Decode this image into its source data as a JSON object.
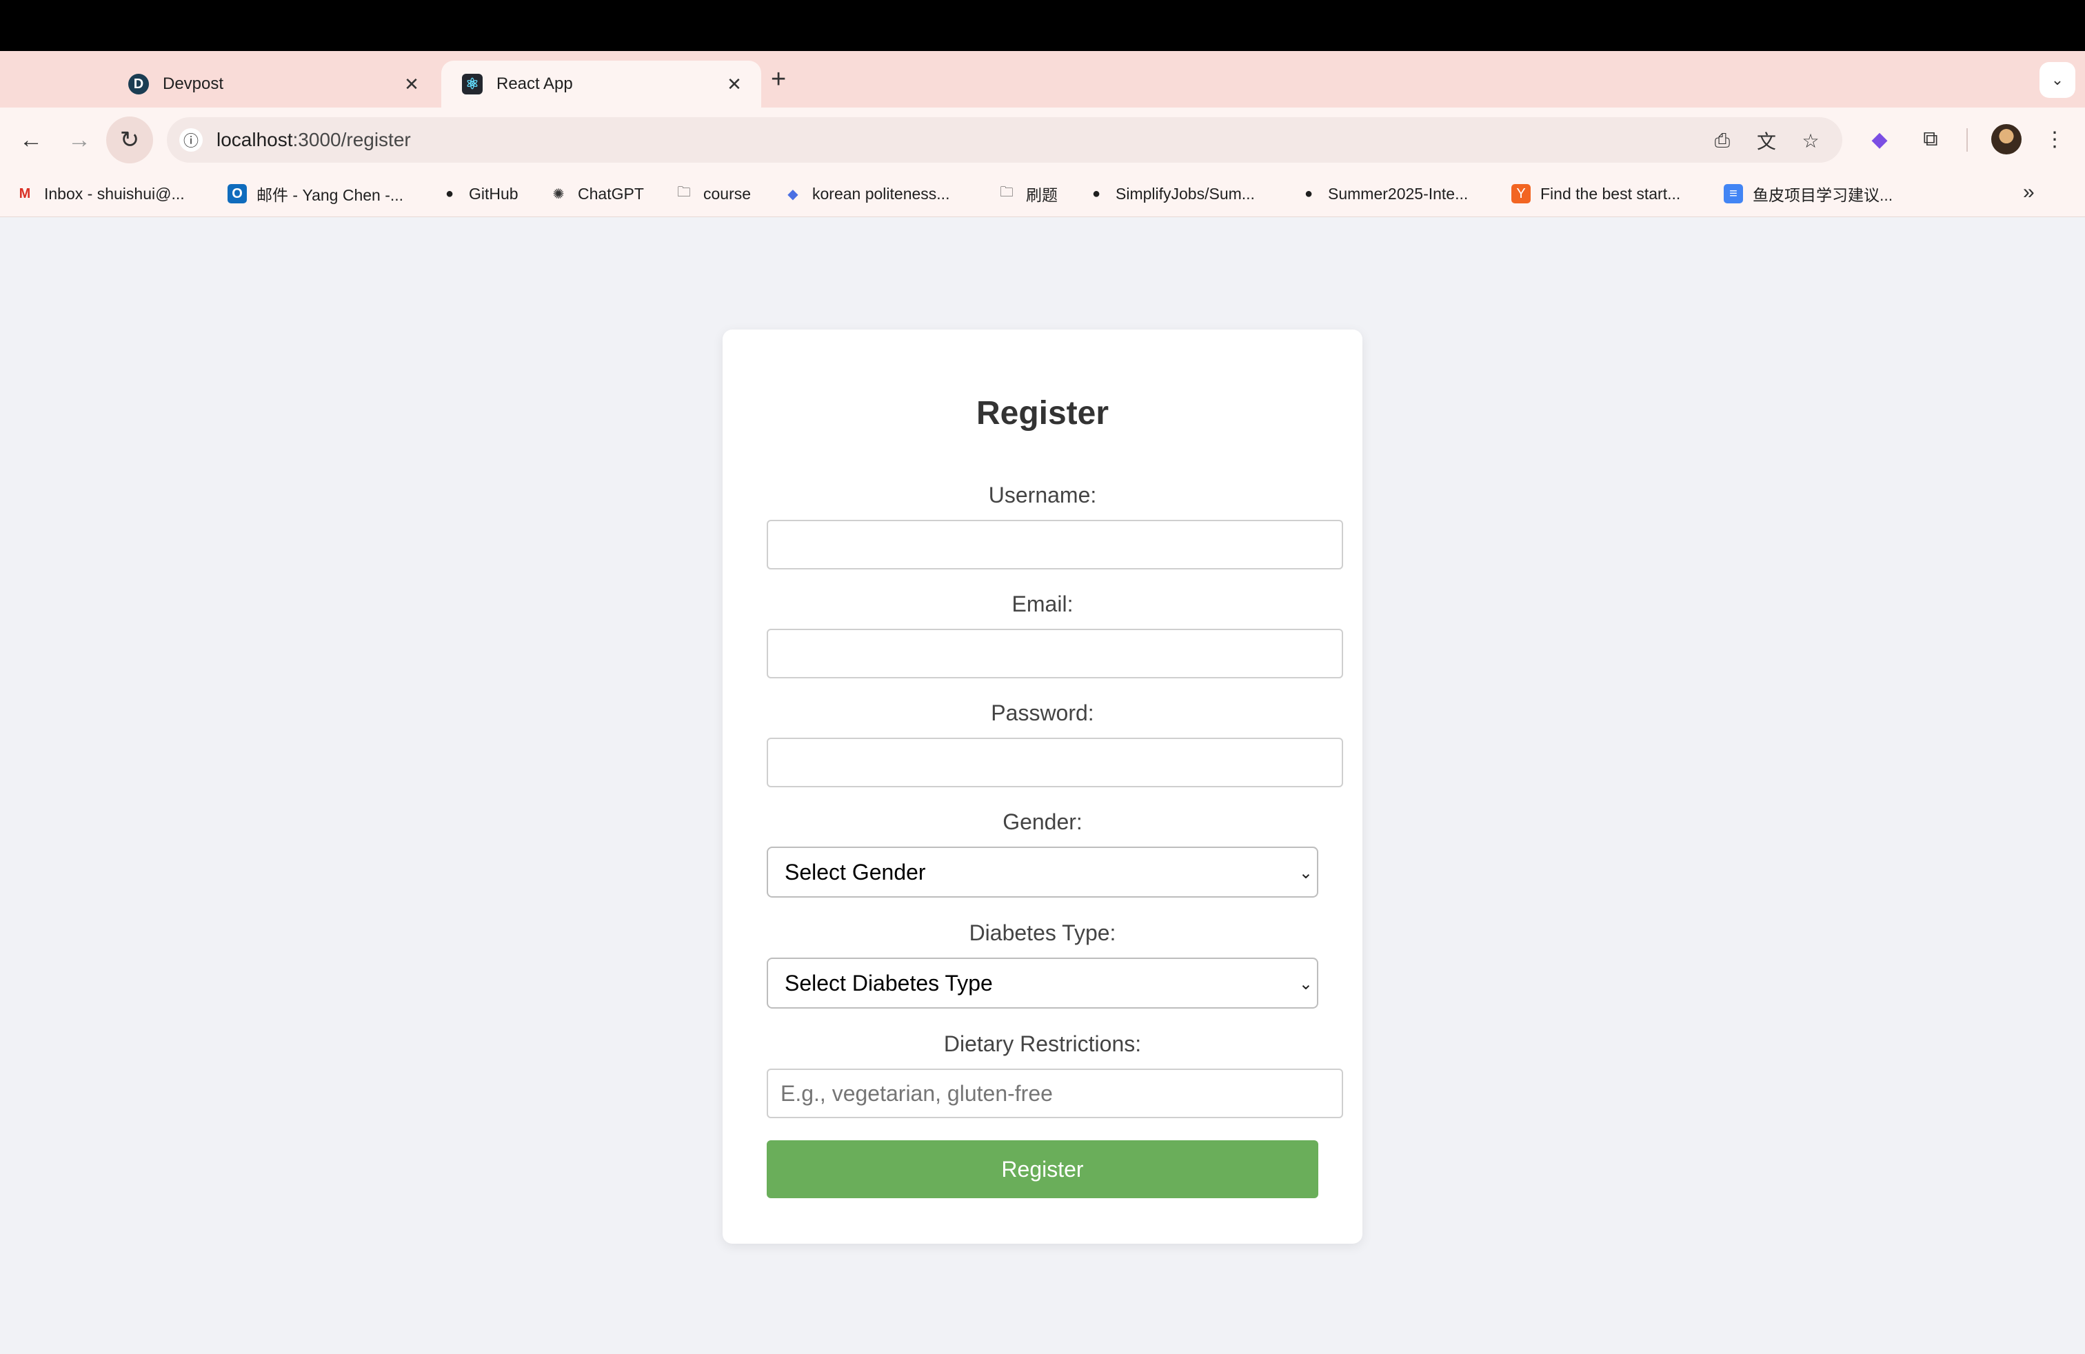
{
  "browser": {
    "tabs": [
      {
        "title": "Devpost",
        "favicon_letter": "D"
      },
      {
        "title": "React App",
        "favicon_letter": "⚛"
      }
    ],
    "address": {
      "host": "localhost",
      "path": ":3000/register"
    },
    "bookmarks": [
      {
        "label": "Inbox - shuishui@...",
        "icon": "gmail-icon",
        "glyph": "M",
        "color": "#d93025"
      },
      {
        "label": "邮件 - Yang Chen -...",
        "icon": "outlook-icon",
        "glyph": "O",
        "color": "#0f6cbd"
      },
      {
        "label": "GitHub",
        "icon": "github-icon",
        "glyph": "●",
        "color": "#1f1f1f"
      },
      {
        "label": "ChatGPT",
        "icon": "chatgpt-icon",
        "glyph": "✺",
        "color": "#333333"
      },
      {
        "label": "course",
        "icon": "folder-icon",
        "glyph": "🗀",
        "color": "#333333"
      },
      {
        "label": "korean politeness...",
        "icon": "bookmark-site-icon",
        "glyph": "◆",
        "color": "#4a6fe3"
      },
      {
        "label": "刷题",
        "icon": "folder-icon",
        "glyph": "🗀",
        "color": "#333333"
      },
      {
        "label": "SimplifyJobs/Sum...",
        "icon": "github-icon",
        "glyph": "●",
        "color": "#1f1f1f"
      },
      {
        "label": "Summer2025-Inte...",
        "icon": "github-icon",
        "glyph": "●",
        "color": "#1f1f1f"
      },
      {
        "label": "Find the best start...",
        "icon": "ycombinator-icon",
        "glyph": "Y",
        "color": "#f26522"
      },
      {
        "label": "鱼皮项目学习建议...",
        "icon": "google-docs-icon",
        "glyph": "≡",
        "color": "#4285f4"
      }
    ]
  },
  "form": {
    "title": "Register",
    "username_label": "Username:",
    "email_label": "Email:",
    "password_label": "Password:",
    "gender_label": "Gender:",
    "gender_value": "Select Gender",
    "diabetes_label": "Diabetes Type:",
    "diabetes_value": "Select Diabetes Type",
    "dietary_label": "Dietary Restrictions:",
    "dietary_placeholder": "E.g., vegetarian, gluten-free",
    "submit_label": "Register"
  },
  "colors": {
    "accent_button": "#6aae5a",
    "tab_strip": "#f9dcd8",
    "page_background": "#f1f2f6"
  }
}
